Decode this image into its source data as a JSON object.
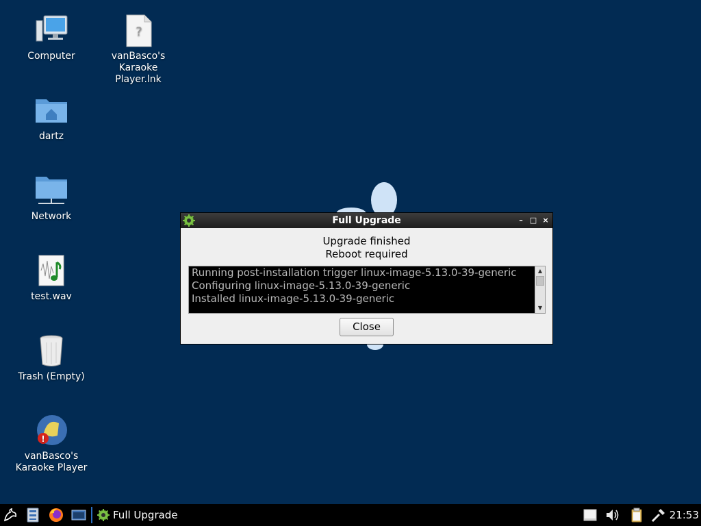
{
  "desktop": {
    "icons": [
      {
        "label": "Computer"
      },
      {
        "label": "vanBasco's\nKaraoke\nPlayer.lnk"
      },
      {
        "label": "dartz"
      },
      {
        "label": "Network"
      },
      {
        "label": "test.wav"
      },
      {
        "label": "Trash (Empty)"
      },
      {
        "label": "vanBasco's\nKaraoke Player"
      }
    ]
  },
  "dialog": {
    "title": "Full Upgrade",
    "icon": "gear-icon",
    "status_line1": "Upgrade finished",
    "status_line2": "Reboot required",
    "log_lines": [
      "Running post-installation trigger linux-image-5.13.0-39-generic",
      "Configuring linux-image-5.13.0-39-generic",
      "Installed linux-image-5.13.0-39-generic"
    ],
    "close_label": "Close",
    "controls": {
      "minimize": "–",
      "maximize": "□",
      "close": "×"
    }
  },
  "taskbar": {
    "launchers": [
      "start-menu-icon",
      "file-manager-icon",
      "firefox-icon",
      "terminal-icon"
    ],
    "task_title": "Full Upgrade",
    "tray": [
      "notes-icon",
      "volume-icon",
      "clipboard-icon",
      "network-icon"
    ],
    "clock": "21:53"
  },
  "colors": {
    "desktop_bg": "#022b53",
    "taskbar_bg": "#000000",
    "dialog_bg": "#efefef",
    "log_bg": "#000000",
    "log_text": "#b9b9b9"
  }
}
